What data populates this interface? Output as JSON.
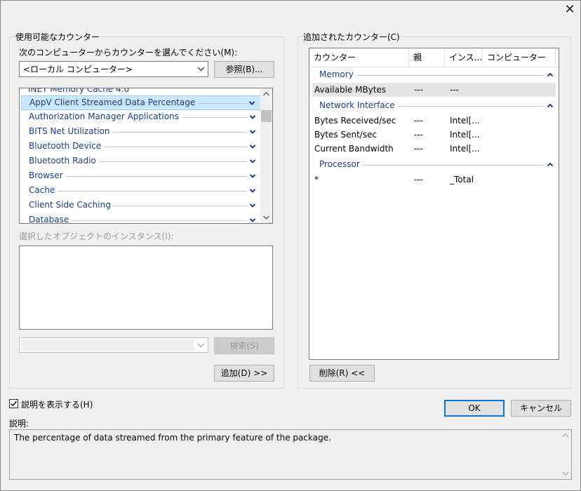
{
  "window": {
    "close_glyph": "✕"
  },
  "available": {
    "group_title": "使用可能なカウンター",
    "computer_prompt": "次のコンピューターからカウンターを選んでください(M):",
    "computer_value": "<ローカル コンピューター>",
    "browse_label": "参照(B)...",
    "partial_top_item": "INET Memory Cache 4.0",
    "categories": [
      "AppV Client Streamed Data Percentage",
      "Authorization Manager Applications",
      "BITS Net Utilization",
      "Bluetooth Device",
      "Bluetooth Radio",
      "Browser",
      "Cache",
      "Client Side Caching",
      "Database"
    ],
    "instances_label": "選択したオブジェクトのインスタンス(I):",
    "search_label": "検索(S)",
    "add_label": "追加(D) >>"
  },
  "added": {
    "group_title": "追加されたカウンター(C)",
    "headers": [
      "カウンター",
      "親",
      "インス...",
      "コンピューター"
    ],
    "objects": [
      {
        "name": "Memory",
        "counters": [
          {
            "name": "Available MBytes",
            "parent": "---",
            "instance": "---",
            "computer": ""
          }
        ]
      },
      {
        "name": "Network Interface",
        "counters": [
          {
            "name": "Bytes Received/sec",
            "parent": "---",
            "instance": "Intel[...",
            "computer": ""
          },
          {
            "name": "Bytes Sent/sec",
            "parent": "---",
            "instance": "Intel[...",
            "computer": ""
          },
          {
            "name": "Current Bandwidth",
            "parent": "---",
            "instance": "Intel[...",
            "computer": ""
          }
        ]
      },
      {
        "name": "Processor",
        "counters": [
          {
            "name": "*",
            "parent": "---",
            "instance": "_Total",
            "computer": ""
          }
        ]
      }
    ],
    "remove_label": "削除(R) <<"
  },
  "footer": {
    "show_desc_label": "説明を表示する(H)",
    "show_desc_checked": true,
    "ok_label": "OK",
    "cancel_label": "キャンセル",
    "desc_label": "説明:",
    "desc_text": "The percentage of data streamed from the primary feature of the package."
  },
  "colors": {
    "accent": "#0078d7",
    "category_text": "#1b3d8f",
    "selection": "#cce8ff"
  }
}
